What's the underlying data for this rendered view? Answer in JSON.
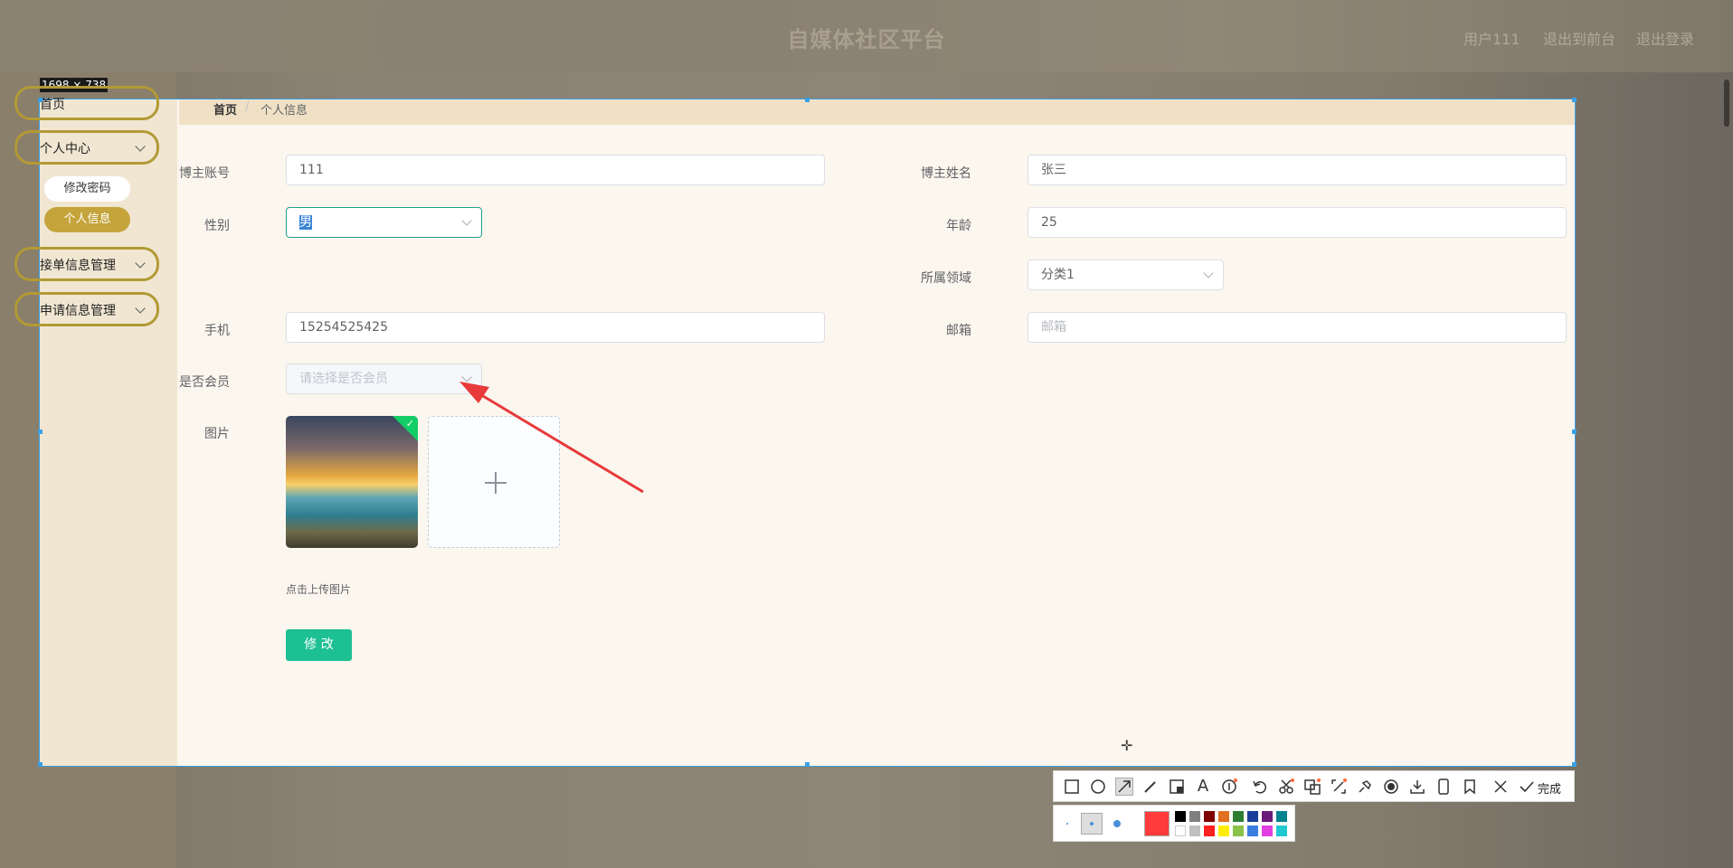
{
  "header": {
    "title": "自媒体社区平台",
    "user_link": "用户111",
    "backend_link": "退出到前台",
    "logout_link": "退出登录"
  },
  "capture": {
    "size_label": "1698 × 738"
  },
  "sidebar": {
    "home": "首页",
    "personal_center": "个人中心",
    "change_password": "修改密码",
    "personal_info": "个人信息",
    "order_mgmt": "接单信息管理",
    "apply_mgmt": "申请信息管理"
  },
  "breadcrumb": {
    "home": "首页",
    "separator": "/",
    "current": "个人信息"
  },
  "form": {
    "account_label": "博主账号",
    "account_value": "111",
    "name_label": "博主姓名",
    "name_value": "张三",
    "gender_label": "性别",
    "gender_value": "男",
    "age_label": "年龄",
    "age_value": "25",
    "field_label": "所属领域",
    "field_value": "分类1",
    "phone_label": "手机",
    "phone_value": "15254525425",
    "email_label": "邮箱",
    "email_placeholder": "邮箱",
    "member_label": "是否会员",
    "member_placeholder": "请选择是否会员",
    "image_label": "图片",
    "upload_hint": "点击上传图片",
    "submit_label": "修 改"
  },
  "toolbar": {
    "done_label": "完成"
  },
  "colors": {
    "accent_gold": "#c8ab38",
    "submit_green": "#1dc093",
    "selection_blue": "#3aa0e6",
    "arrow_red": "#e83a3a",
    "current_color": "#ff3b3b"
  }
}
